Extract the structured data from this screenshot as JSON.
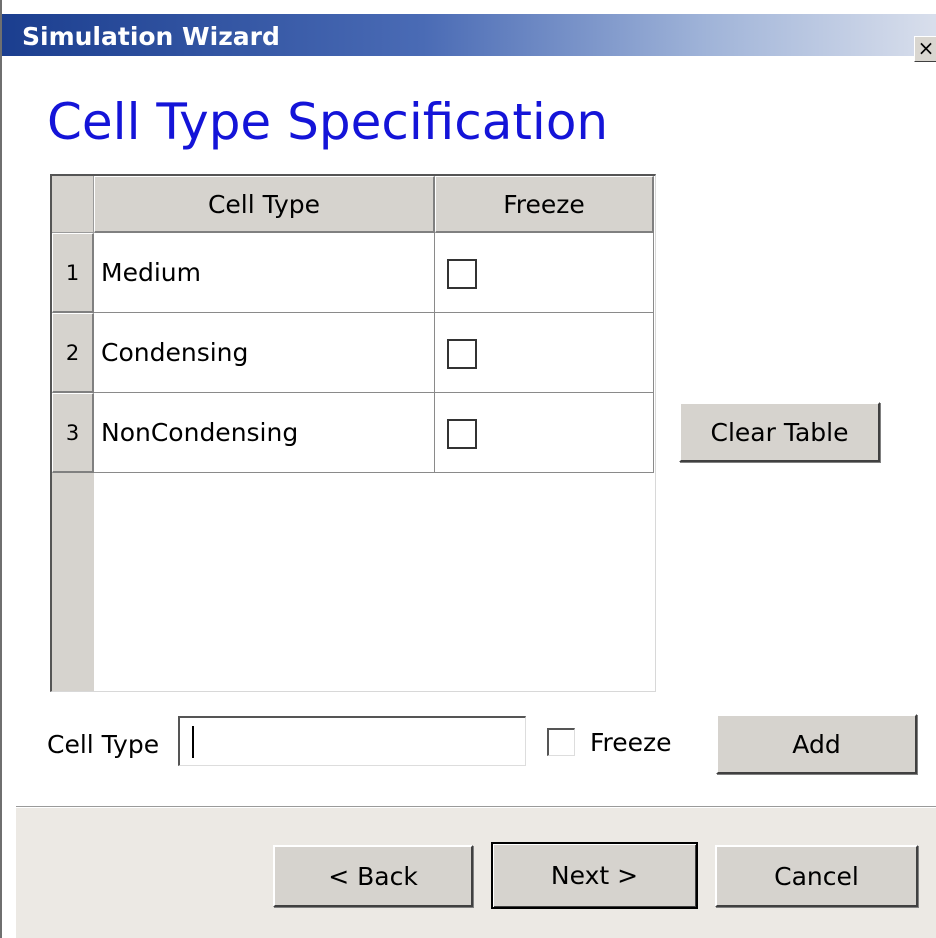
{
  "window": {
    "title": "Simulation Wizard",
    "close_glyph": "×"
  },
  "page": {
    "heading": "Cell Type Specification",
    "heading_color": "#1414d8"
  },
  "table": {
    "columns": [
      "Cell Type",
      "Freeze"
    ],
    "rows": [
      {
        "num": "1",
        "cell_type": "Medium",
        "freeze": false
      },
      {
        "num": "2",
        "cell_type": "Condensing",
        "freeze": false
      },
      {
        "num": "3",
        "cell_type": "NonCondensing",
        "freeze": false
      }
    ]
  },
  "side": {
    "clear_label": "Clear Table"
  },
  "form": {
    "cell_type_label": "Cell Type",
    "cell_type_value": "",
    "freeze_label": "Freeze",
    "freeze_checked": false,
    "add_label": "Add"
  },
  "nav": {
    "back_label": "< Back",
    "next_label": "Next >",
    "cancel_label": "Cancel"
  }
}
